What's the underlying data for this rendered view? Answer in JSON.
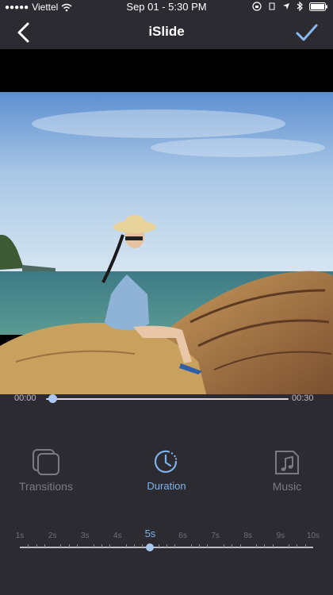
{
  "status_bar": {
    "carrier": "Viettel",
    "time": "Sep 01 - 5:30 PM"
  },
  "nav": {
    "title": "iSlide"
  },
  "scrubber": {
    "start": "00:00",
    "end": "00:30",
    "progress": 0.03
  },
  "tools": [
    {
      "label": "Transitions",
      "icon": "transitions-icon",
      "active": false
    },
    {
      "label": "Duration",
      "icon": "duration-icon",
      "active": true
    },
    {
      "label": "Music",
      "icon": "music-icon",
      "active": false
    }
  ],
  "duration": {
    "ticks": [
      "1s",
      "2s",
      "3s",
      "4s",
      "5s",
      "6s",
      "7s",
      "8s",
      "9s",
      "10s"
    ],
    "selected": "5s"
  },
  "colors": {
    "accent": "#7fb2ec",
    "background": "#2b2b31"
  }
}
